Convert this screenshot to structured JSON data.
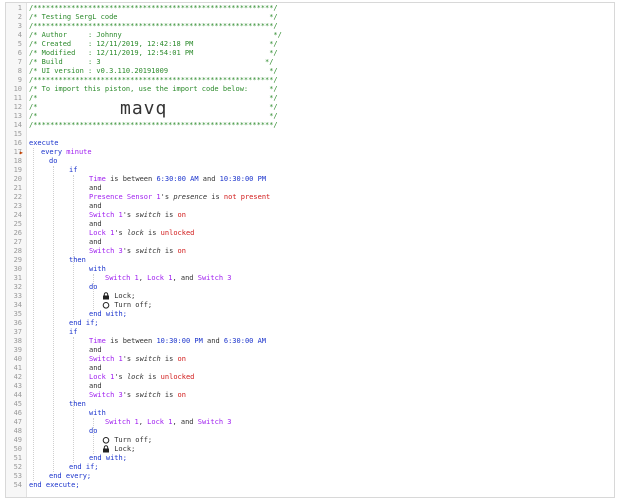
{
  "header": {
    "stars": "/*********************************************************/",
    "title": "/* Testing SergL code                                    */",
    "author": "/* Author     : Johnny                                    */",
    "created": "/* Created    : 12/11/2019, 12:42:18 PM                  */",
    "modified": "/* Modified   : 12/11/2019, 12:54:01 PM                  */",
    "build": "/* Build      : 3                                       */",
    "ui": "/* UI version : v0.3.110.20191009                        */",
    "import": "/* To import this piston, use the import code below:     */",
    "blank": "/*                                                       */",
    "import_code": "mavq"
  },
  "lines": {
    "n1": "1",
    "n2": "2",
    "n3": "3",
    "n4": "4",
    "n5": "5",
    "n6": "6",
    "n7": "7",
    "n8": "8",
    "n9": "9",
    "n10": "10",
    "n11": "11",
    "n12": "12",
    "n13": "13",
    "n14": "14",
    "n15": "15",
    "n16": "16",
    "n17": "17",
    "n18": "18",
    "n19": "19",
    "n20": "20",
    "n21": "21",
    "n22": "22",
    "n23": "23",
    "n24": "24",
    "n25": "25",
    "n26": "26",
    "n27": "27",
    "n28": "28",
    "n29": "29",
    "n30": "30",
    "n31": "31",
    "n32": "32",
    "n33": "33",
    "n34": "34",
    "n35": "35",
    "n36": "36",
    "n37": "37",
    "n38": "38",
    "n39": "39",
    "n40": "40",
    "n41": "41",
    "n42": "42",
    "n43": "43",
    "n44": "44",
    "n45": "45",
    "n46": "46",
    "n47": "47",
    "n48": "48",
    "n49": "49",
    "n50": "50",
    "n51": "51",
    "n52": "52",
    "n53": "53",
    "n54": "54"
  },
  "code": {
    "execute": "execute",
    "every": "every",
    "minute": "minute",
    "do": "do",
    "if": "if",
    "time": "Time",
    "is_between": " is between ",
    "t1": "6:30:00 AM",
    "and_inline": " and ",
    "t2": "10:30:00 PM",
    "and": "and",
    "presence_sensor": "Presence Sensor 1",
    "apos_s": "'s ",
    "presence": "presence",
    "is": " is ",
    "not_present": "not present",
    "switch1": "Switch 1",
    "switch": "switch",
    "on": "on",
    "lock1": "Lock 1",
    "lock": "lock",
    "unlocked": "unlocked",
    "switch3": "Switch 3",
    "then": "then",
    "with": "with",
    "comma": ", ",
    "and_comma": ", and ",
    "lock_action": "Lock;",
    "turn_off": "Turn off;",
    "end_with": "end with;",
    "end_if": "end if;",
    "t3": "10:30:00 PM",
    "t4": "6:30:00 AM",
    "end_every": "end every;",
    "end_execute": "end execute;"
  },
  "colors": {
    "comment": "#2b8a2b",
    "keyword": "#1a33cc",
    "device": "#a020f0",
    "value": "#d11a1a"
  },
  "icons": {
    "lock": "lock-icon",
    "power": "power-icon"
  }
}
